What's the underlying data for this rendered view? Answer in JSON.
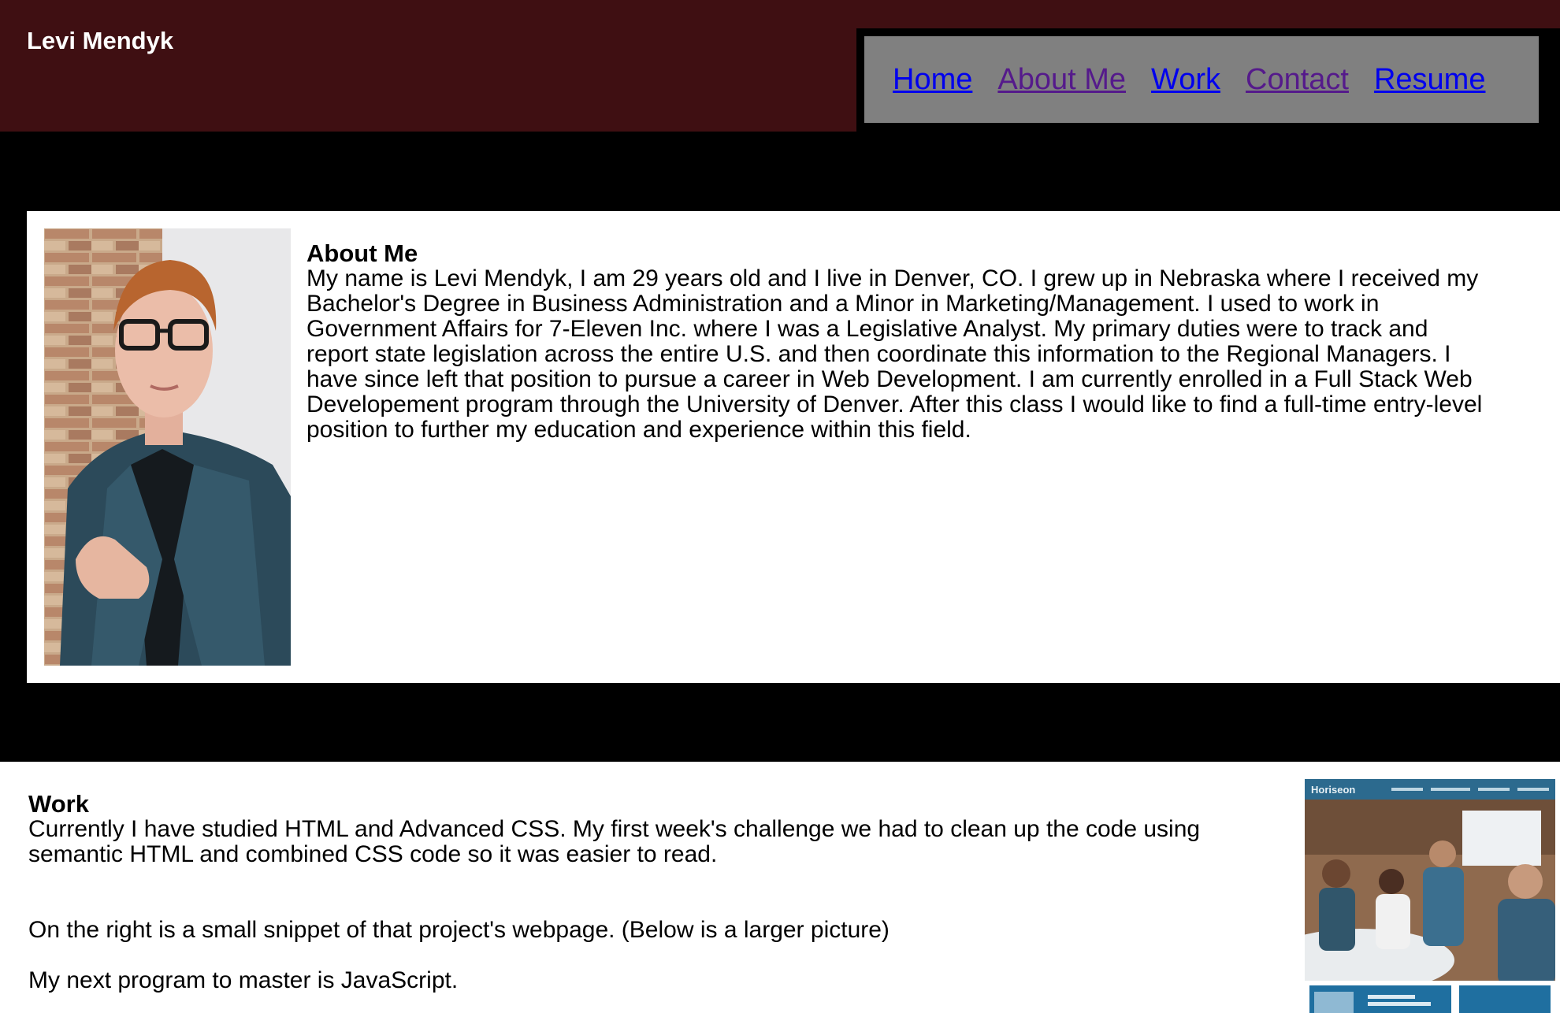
{
  "header": {
    "site_title": "Levi Mendyk",
    "nav": [
      "Home",
      "About Me",
      "Work",
      "Contact",
      "Resume"
    ]
  },
  "about": {
    "heading": "About Me",
    "lines": [
      "My name is Levi Mendyk, I am 29 years old and I live in Denver, CO. I grew up in Nebraska where I received my",
      "Bachelor's Degree in Business Administration and a Minor in Marketing/Management. I used to work in",
      "Government Affairs for 7-Eleven Inc. where I was a Legislative Analyst. My primary duties were to track and",
      "report state legislation across the entire U.S. and then coordinate this information to the Regional Managers. I",
      "have since left that position to pursue a career in Web Development. I am currently enrolled in a Full Stack Web",
      "Developement program through the University of Denver. After this class I would like to find a full-time entry-level",
      "position to further my education and experience within this field."
    ]
  },
  "work": {
    "heading": "Work",
    "p1_lines": [
      "Currently I have studied HTML and Advanced CSS. My first week's challenge we had to clean up the code using",
      "semantic HTML and combined CSS code so it was easier to read."
    ],
    "p2": "On the right is a small snippet of that project's webpage. (Below is a larger picture)",
    "p3": "My next program to master is JavaScript.",
    "snippet_brand": "Horiseon"
  },
  "colors": {
    "header_bg": "#3f0f12",
    "nav_bg": "#808080",
    "band_bg": "#000000",
    "link": "#0000ee",
    "visited": "#551a8b"
  }
}
